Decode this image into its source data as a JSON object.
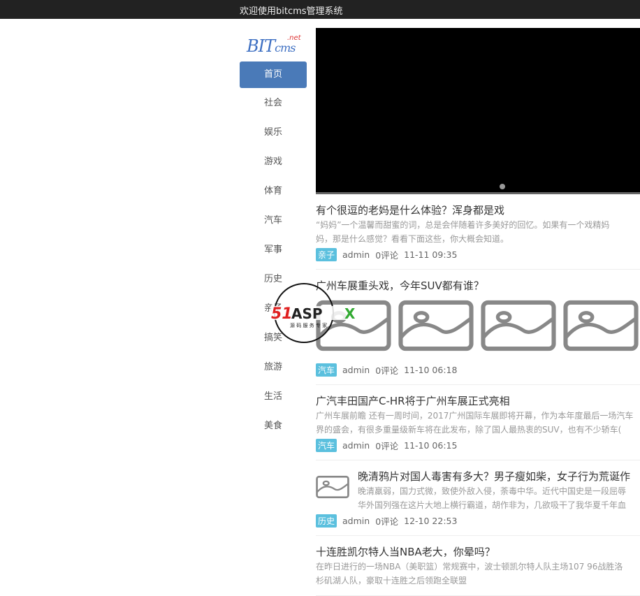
{
  "header": {
    "title": "欢迎使用bitcms管理系统"
  },
  "logo": {
    "main": "BIT",
    "sub": "cms",
    "suffix": ".net"
  },
  "sidebar": {
    "items": [
      {
        "label": "首页",
        "active": true
      },
      {
        "label": "社会"
      },
      {
        "label": "娱乐"
      },
      {
        "label": "游戏"
      },
      {
        "label": "体育"
      },
      {
        "label": "汽车"
      },
      {
        "label": "军事"
      },
      {
        "label": "历史"
      },
      {
        "label": "亲子"
      },
      {
        "label": "搞笑"
      },
      {
        "label": "旅游"
      },
      {
        "label": "生活"
      },
      {
        "label": "美食"
      }
    ]
  },
  "articles": [
    {
      "title": "有个很逗的老妈是什么体验？浑身都是戏",
      "desc1": "“妈妈”一个温馨而甜蜜的词，总是会伴随着许多美好的回忆。如果有一个戏精妈",
      "desc2": "妈，那是什么感觉？看看下面这些，你大概会知道。",
      "tag": "亲子",
      "author": "admin",
      "comments": "0评论",
      "time": "11-11 09:35"
    },
    {
      "title": "广州车展重头戏，今年SUV都有谁？",
      "tag": "汽车",
      "author": "admin",
      "comments": "0评论",
      "time": "11-10 06:18"
    },
    {
      "title": "广汽丰田国产C-HR将于广州车展正式亮相",
      "desc1": "广州车展前瞻 还有一周时间，2017广州国际车展即将开幕，作为本年度最后一场汽车",
      "desc2": "界的盛会，有很多重量级新车将在此发布，除了国人最热衷的SUV，也有不少轿车(",
      "tag": "汽车",
      "author": "admin",
      "comments": "0评论",
      "time": "11-10 06:15"
    },
    {
      "title": "晚清鸦片对国人毒害有多大？男子瘦如柴，女子行为荒诞作",
      "desc1": "晚清羸弱，国力式微，致使外敌入侵，荼毒中华。近代中国史是一段屈辱",
      "desc2": "华外国列强在这片大地上横行霸道，胡作非为，几欲吸干了我华夏千年血",
      "tag": "历史",
      "author": "admin",
      "comments": "0评论",
      "time": "12-10 22:53"
    },
    {
      "title": "十连胜凯尔特人当NBA老大，你晕吗？",
      "desc1": "在昨日进行的一场NBA（美职篮）常规赛中，波士顿凯尔特人队主场107 96战胜洛",
      "desc2": "杉矶湖人队，豪取十连胜之后领跑全联盟"
    }
  ],
  "watermark": {
    "text": "51ASPX",
    "sub": "源码服务专家"
  }
}
